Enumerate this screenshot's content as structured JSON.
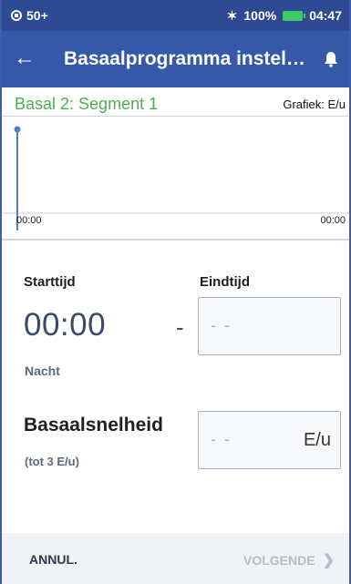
{
  "status_bar": {
    "notification": "50+",
    "battery_percent": "100%",
    "time": "04:47",
    "battery_color": "#3ec96a"
  },
  "header": {
    "title": "Basaalprogramma instel…"
  },
  "segment": {
    "title": "Basal 2: Segment 1",
    "graph_unit_label": "Grafiek: E/u"
  },
  "chart_data": {
    "type": "line",
    "x_tick_labels": [
      "00:00",
      "00:00"
    ],
    "series": [
      {
        "x": [
          0
        ],
        "y": [
          0
        ]
      }
    ]
  },
  "form": {
    "start_label": "Starttijd",
    "end_label": "Eindtijd",
    "start_value": "00:00",
    "separator": "-",
    "period_label": "Nacht",
    "end_placeholder": "- -",
    "rate_label": "Basaalsnelheid",
    "rate_hint": "(tot 3 E/u)",
    "rate_placeholder": "- -",
    "rate_unit": "E/u"
  },
  "footer": {
    "cancel_label": "ANNUL.",
    "next_label": "VOLGENDE",
    "next_enabled": false
  },
  "colors": {
    "header_bg": "#3559a8",
    "segment_title": "#4caf50",
    "chart_line": "#4a82c4"
  }
}
